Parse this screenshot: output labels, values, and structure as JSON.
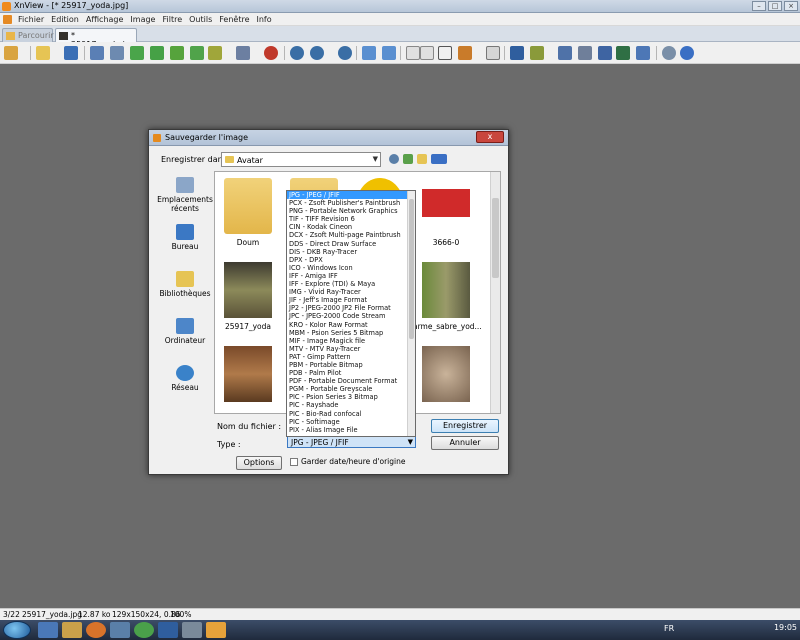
{
  "window": {
    "title": "XnView - [* 25917_yoda.jpg]",
    "buttons": [
      "–",
      "□",
      "×"
    ]
  },
  "menu": {
    "items": [
      "Fichier",
      "Edition",
      "Affichage",
      "Image",
      "Filtre",
      "Outils",
      "Fenêtre",
      "Info"
    ]
  },
  "tabs": [
    {
      "label": "Parcourir",
      "active": false
    },
    {
      "label": "* 25917_yoda.jpg",
      "active": true
    }
  ],
  "toolbar": {
    "icons": [
      "new-icon",
      "open-folder-icon",
      "save-icon",
      "rotate-left-icon",
      "crop-icon",
      "rotate-icon",
      "rotate-right-icon",
      "adjust-icon",
      "filter-icon",
      "color-icon",
      "effect-icon",
      "zoom-in-icon",
      "zoom-icon",
      "zoom-out-icon",
      "prev-icon",
      "next-icon",
      "fit-icon",
      "fullscreen-icon",
      "compare-icon",
      "slideshow-icon",
      "copy-icon",
      "fullscreen-toggle-icon",
      "info-icon",
      "find-icon",
      "print-icon",
      "scan-icon",
      "wallpaper-icon",
      "capture-icon",
      "settings-icon",
      "about-icon"
    ]
  },
  "dialog": {
    "title": "Sauvegarder l'image",
    "close_label": "x",
    "save_in_label": "Enregistrer dans :",
    "save_in_value": "Avatar",
    "places": [
      "Emplacements récents",
      "Bureau",
      "Bibliothèques",
      "Ordinateur",
      "Réseau"
    ],
    "files": [
      {
        "name": "Doum",
        "kind": "folder"
      },
      {
        "name": "",
        "kind": "folder"
      },
      {
        "name": "",
        "kind": "folder"
      },
      {
        "name": "3666-0",
        "kind": "image"
      },
      {
        "name": "25917_yoda",
        "kind": "image"
      },
      {
        "name": "arme_sabre_yod...",
        "kind": "image"
      },
      {
        "name": "",
        "kind": "image"
      },
      {
        "name": "",
        "kind": "image"
      }
    ],
    "filename_label": "Nom du fichier :",
    "type_label": "Type :",
    "type_value": "JPG - JPEG / JFIF",
    "save_button": "Enregistrer",
    "cancel_button": "Annuler",
    "options_button": "Options",
    "keep_date_label": "Garder date/heure d'origine",
    "type_options": [
      "JPG - JPEG / JFIF",
      "PCX - Zsoft Publisher's Paintbrush",
      "PNG - Portable Network Graphics",
      "TIF - TIFF Revision 6",
      "CIN - Kodak Cineon",
      "DCX - Zsoft Multi-page Paintbrush",
      "DDS - Direct Draw Surface",
      "DIS - DKB Ray-Tracer",
      "DPX - DPX",
      "ICO - Windows Icon",
      "IFF - Amiga IFF",
      "IFF - Explore (TDI) & Maya",
      "IMG - Vivid Ray-Tracer",
      "JIF - Jeff's Image Format",
      "JP2 - JPEG-2000 JP2 File Format",
      "JPC - JPEG-2000 Code Stream",
      "KRO - Kolor Raw Format",
      "MBM - Psion Series 5 Bitmap",
      "MIF - Image Magick file",
      "MTV - MTV Ray-Tracer",
      "PAT - Gimp Pattern",
      "PBM - Portable Bitmap",
      "PDB - Palm Pilot",
      "PDF - Portable Document Format",
      "PGM - Portable Greyscale",
      "PIC - Psion Series 3 Bitmap",
      "PIC - Rayshade",
      "PIC - Bio-Rad confocal",
      "PIC - Softimage",
      "PIX - Alias Image File"
    ]
  },
  "status": {
    "index": "3/22",
    "filename": "25917_yoda.jpg",
    "size": "12.87 ko",
    "dimensions": "129x150x24, 0.86",
    "zoom": "100%"
  },
  "taskbar": {
    "lang": "FR",
    "time": "19:05"
  }
}
